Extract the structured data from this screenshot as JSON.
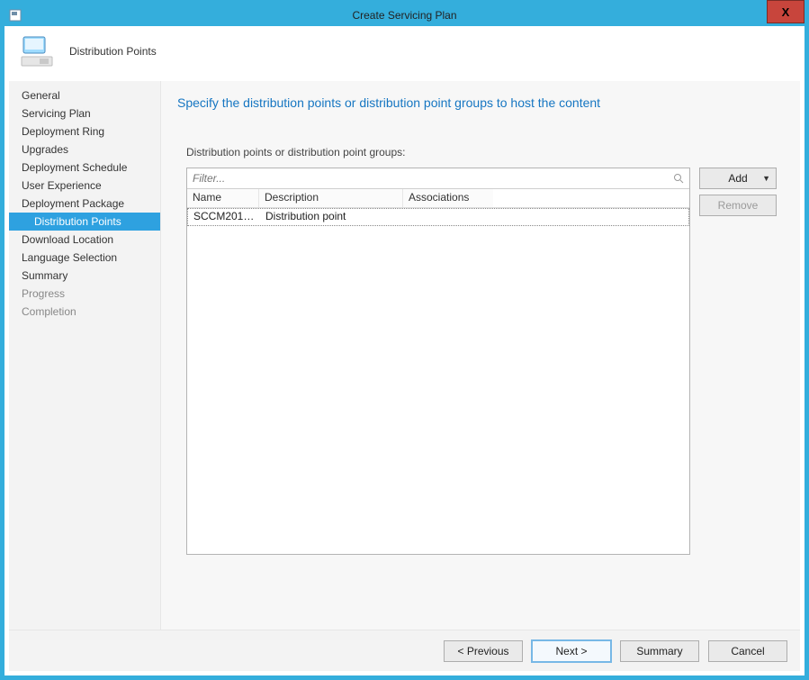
{
  "window": {
    "title": "Create Servicing Plan",
    "close_symbol": "X"
  },
  "header": {
    "page_name": "Distribution Points"
  },
  "sidebar": {
    "items": [
      {
        "label": "General",
        "state": "normal"
      },
      {
        "label": "Servicing Plan",
        "state": "normal"
      },
      {
        "label": "Deployment Ring",
        "state": "normal"
      },
      {
        "label": "Upgrades",
        "state": "normal"
      },
      {
        "label": "Deployment Schedule",
        "state": "normal"
      },
      {
        "label": "User Experience",
        "state": "normal"
      },
      {
        "label": "Deployment Package",
        "state": "normal"
      },
      {
        "label": "Distribution Points",
        "state": "selected"
      },
      {
        "label": "Download Location",
        "state": "normal"
      },
      {
        "label": "Language Selection",
        "state": "normal"
      },
      {
        "label": "Summary",
        "state": "normal"
      },
      {
        "label": "Progress",
        "state": "disabled"
      },
      {
        "label": "Completion",
        "state": "disabled"
      }
    ]
  },
  "main": {
    "heading": "Specify the distribution points or distribution point groups to host the content",
    "list_label": "Distribution points or distribution point groups:",
    "filter_placeholder": "Filter...",
    "columns": {
      "name": "Name",
      "description": "Description",
      "associations": "Associations"
    },
    "rows": [
      {
        "name": "SCCM2012....",
        "description": "Distribution point",
        "associations": ""
      }
    ],
    "buttons": {
      "add": "Add",
      "remove": "Remove"
    }
  },
  "footer": {
    "previous": "< Previous",
    "next": "Next >",
    "summary": "Summary",
    "cancel": "Cancel"
  }
}
